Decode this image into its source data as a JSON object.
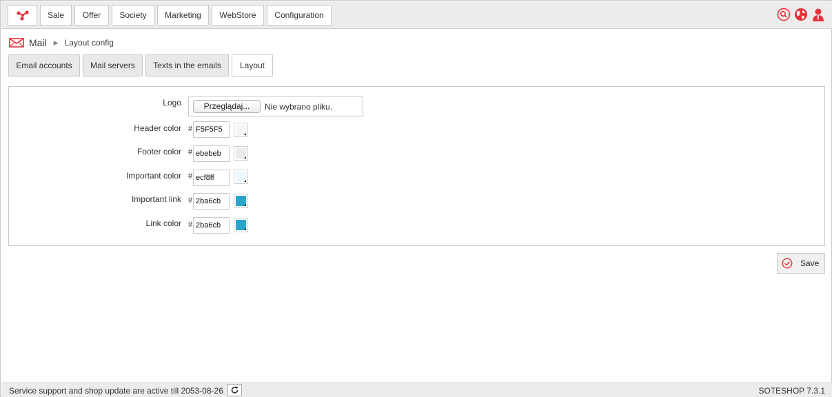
{
  "topnav": {
    "items": [
      "Sale",
      "Offer",
      "Society",
      "Marketing",
      "WebStore",
      "Configuration"
    ]
  },
  "breadcrumb": {
    "section": "Mail",
    "current": "Layout config"
  },
  "tabs": [
    "Email accounts",
    "Mail servers",
    "Texts in the emails",
    "Layout"
  ],
  "active_tab": "Layout",
  "form": {
    "logo_label": "Logo",
    "file_button": "Przeglądaj...",
    "file_status": "Nie wybrano pliku.",
    "hash": "#",
    "colors": [
      {
        "label": "Header color",
        "value": "F5F5F5",
        "swatch": "#f5f5f5"
      },
      {
        "label": "Footer color",
        "value": "ebebeb",
        "swatch": "#ebebeb"
      },
      {
        "label": "Important color",
        "value": "ecf8ff",
        "swatch": "#ecf8ff"
      },
      {
        "label": "Important link",
        "value": "2ba6cb",
        "swatch": "#2ba6cb"
      },
      {
        "label": "Link color",
        "value": "2ba6cb",
        "swatch": "#2ba6cb"
      }
    ]
  },
  "actions": {
    "save_label": "Save"
  },
  "footer": {
    "support_text": "Service support and shop update are active till 2053-08-26",
    "version": "SOTESHOP 7.3.1"
  },
  "colors": {
    "accent": "#e8323c"
  }
}
